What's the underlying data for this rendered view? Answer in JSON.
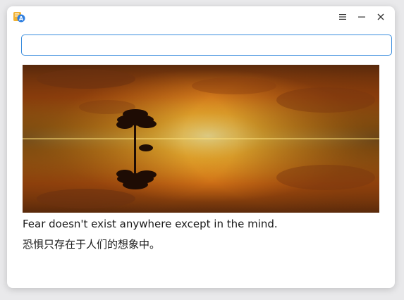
{
  "window": {
    "app_icon": "app-translator-icon",
    "controls": {
      "menu_icon": "hamburger-menu-icon",
      "minimize_icon": "minimize-icon",
      "close_icon": "close-icon"
    }
  },
  "search": {
    "value": "",
    "placeholder": ""
  },
  "content": {
    "image": "sunset-lone-tree-reflection-photo",
    "quote_en": "Fear doesn't exist anywhere except in the mind.",
    "quote_zh": "恐惧只存在于人们的想象中。"
  },
  "colors": {
    "input_border": "#3a8dde",
    "window_bg": "#ffffff",
    "desktop_bg": "#e9e9eb"
  }
}
